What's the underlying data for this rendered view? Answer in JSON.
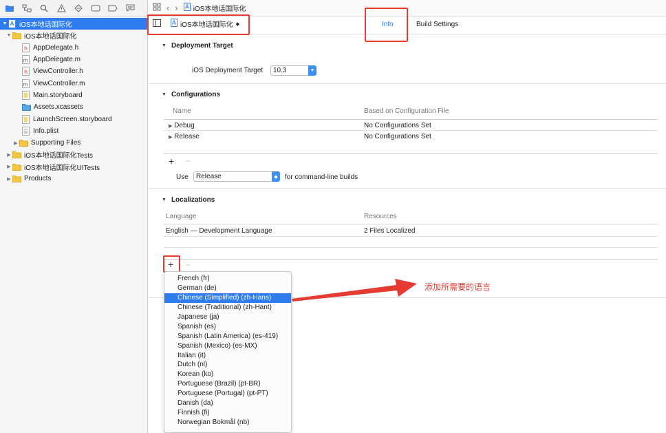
{
  "navigator": {
    "toolbar_icons": [
      "folder-icon",
      "hierarchy-icon",
      "search-icon",
      "warning-icon",
      "test-diamond-icon",
      "debug-icon",
      "breakpoint-icon",
      "report-icon"
    ],
    "items": [
      {
        "label": "iOS本地话国际化",
        "type": "project",
        "level": 0,
        "disclosure": "▼",
        "selected": true
      },
      {
        "label": "iOS本地话国际化",
        "type": "folder",
        "level": 1,
        "disclosure": "▼"
      },
      {
        "label": "AppDelegate.h",
        "type": "h",
        "level": 2
      },
      {
        "label": "AppDelegate.m",
        "type": "m",
        "level": 2
      },
      {
        "label": "ViewController.h",
        "type": "h",
        "level": 2
      },
      {
        "label": "ViewController.m",
        "type": "m",
        "level": 2
      },
      {
        "label": "Main.storyboard",
        "type": "storyboard",
        "level": 2
      },
      {
        "label": "Assets.xcassets",
        "type": "assets",
        "level": 2
      },
      {
        "label": "LaunchScreen.storyboard",
        "type": "storyboard",
        "level": 2
      },
      {
        "label": "Info.plist",
        "type": "plist",
        "level": 2
      },
      {
        "label": "Supporting Files",
        "type": "folder",
        "level": 2,
        "disclosure": "▶"
      },
      {
        "label": "iOS本地话国际化Tests",
        "type": "folder",
        "level": 1,
        "disclosure": "▶"
      },
      {
        "label": "iOS本地话国际化UITests",
        "type": "folder",
        "level": 1,
        "disclosure": "▶"
      },
      {
        "label": "Products",
        "type": "folder",
        "level": 1,
        "disclosure": "▶"
      }
    ]
  },
  "jumpbar": {
    "file": "iOS本地话国际化"
  },
  "tabs": {
    "target": "iOS本地话国际化",
    "info": "Info",
    "build_settings": "Build Settings"
  },
  "deployment": {
    "title": "Deployment Target",
    "label": "iOS Deployment Target",
    "value": "10.3"
  },
  "configurations": {
    "title": "Configurations",
    "col_name": "Name",
    "col_file": "Based on Configuration File",
    "rows": [
      {
        "name": "Debug",
        "file": "No Configurations Set"
      },
      {
        "name": "Release",
        "file": "No Configurations Set"
      }
    ],
    "use_label": "Use",
    "use_value": "Release",
    "use_suffix": "for command-line builds"
  },
  "localizations": {
    "title": "Localizations",
    "col_language": "Language",
    "col_resources": "Resources",
    "row_language": "English — Development Language",
    "row_resources": "2 Files Localized"
  },
  "buttons": {
    "plus": "+",
    "minus": "−"
  },
  "dropdown": {
    "items": [
      "French (fr)",
      "German (de)",
      "Chinese (Simplified) (zh-Hans)",
      "Chinese (Traditional) (zh-Hant)",
      "Japanese (ja)",
      "Spanish (es)",
      "Spanish (Latin America) (es-419)",
      "Spanish (Mexico) (es-MX)",
      "Italian (it)",
      "Dutch (nl)",
      "Korean (ko)",
      "Portuguese (Brazil) (pt-BR)",
      "Portuguese (Portugal) (pt-PT)",
      "Danish (da)",
      "Finnish (fi)",
      "Norwegian Bokmål (nb)"
    ],
    "selected_index": 2
  },
  "annotation": {
    "text": "添加所需要的语言",
    "color": "#e53b32"
  },
  "colors": {
    "accent": "#2f7bf0",
    "annotation_red": "#e53b32"
  }
}
